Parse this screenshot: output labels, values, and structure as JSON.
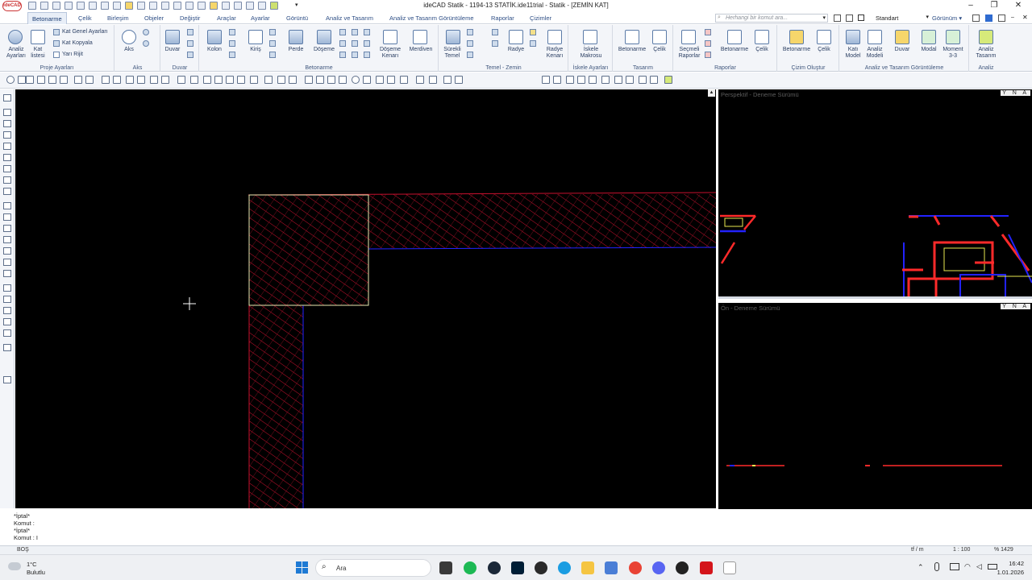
{
  "window": {
    "title": "ideCAD Statik - 1194-13 STATİK.ide11trial - Statik - [ZEMİN KAT]",
    "logo": "ideCAD",
    "controls": [
      "–",
      "❐",
      "✕"
    ],
    "search_placeholder": "Herhangi bir komut ara...",
    "workspace": "Standart",
    "view_menu": "Görünüm"
  },
  "tabs": [
    "Betonarme",
    "Çelik",
    "Birleşim",
    "Objeler",
    "Değiştir",
    "Araçlar",
    "Ayarlar",
    "Görüntü",
    "Analiz ve Tasarım",
    "Analiz ve Tasarım Görüntüleme",
    "Raporlar",
    "Çizimler"
  ],
  "active_tab": "Betonarme",
  "ribbon": {
    "proje": {
      "label": "Proje Ayarları",
      "analiz_ayarlari": "Analiz\nAyarları",
      "kat_listesi": "Kat\nlistesi",
      "kat_genel": "Kat Genel Ayarları",
      "kat_kopyala": "Kat Kopyala",
      "yari_rijit": "Yarı Rijit"
    },
    "aks": {
      "label": "Aks",
      "btn": "Aks"
    },
    "duvar": {
      "label": "Duvar",
      "btn": "Duvar"
    },
    "betonarme": {
      "label": "Betonarme",
      "kolon": "Kolon",
      "kiris": "Kiriş",
      "perde": "Perde",
      "doseme": "Döşeme",
      "doseme_kenari": "Döşeme\nKenarı",
      "merdiven": "Merdiven"
    },
    "temel": {
      "label": "Temel - Zemin",
      "surekli": "Sürekli\nTemel",
      "radye": "Radye",
      "radye_kenari": "Radye\nKenarı"
    },
    "iskele": {
      "label": "İskele Ayarları",
      "btn": "İskele\nMakrosu"
    },
    "tasarim": {
      "label": "Tasarım",
      "betonarme": "Betonarme",
      "celik": "Çelik"
    },
    "raporlar": {
      "label": "Raporlar",
      "secmeli": "Seçmeli\nRaporlar",
      "betonarme": "Betonarme",
      "celik": "Çelik"
    },
    "cizim": {
      "label": "Çizim Oluştur",
      "betonarme": "Betonarme",
      "celik": "Çelik"
    },
    "agoruntu": {
      "label": "Analiz ve Tasarım Görüntüleme",
      "kati_model": "Katı\nModel",
      "analiz_modeli": "Analiz\nModeli",
      "duvar": "Duvar",
      "modal": "Modal",
      "moment": "Moment\n3-3"
    },
    "analiz": {
      "label": "Analiz",
      "btn": "Analiz\nTasarım"
    }
  },
  "viewports": {
    "perspective_title": "Perspektif - Deneme Sürümü",
    "front_title": "Ön - Deneme Sürümü",
    "view_buttons": "Y N A"
  },
  "command_lines": [
    "*İptal*",
    "Komut :",
    "*İptal*",
    "Komut : I"
  ],
  "status": {
    "mode": "BOŞ",
    "unit": "tf / m",
    "scale": "1 : 100",
    "zoom": "% 1429"
  },
  "taskbar": {
    "weather_temp": "1°C",
    "weather_desc": "Bulutlu",
    "search": "Ara",
    "time": "16:42",
    "date": "1.01.2026"
  },
  "colors": {
    "ribbon_bg": "#f3f5f9",
    "canvas_bg": "#000000",
    "hatch": "#c8102e",
    "wall_outline": "#2222ff",
    "column_outline": "#e8e8b0",
    "accent": "#2f4f86"
  }
}
